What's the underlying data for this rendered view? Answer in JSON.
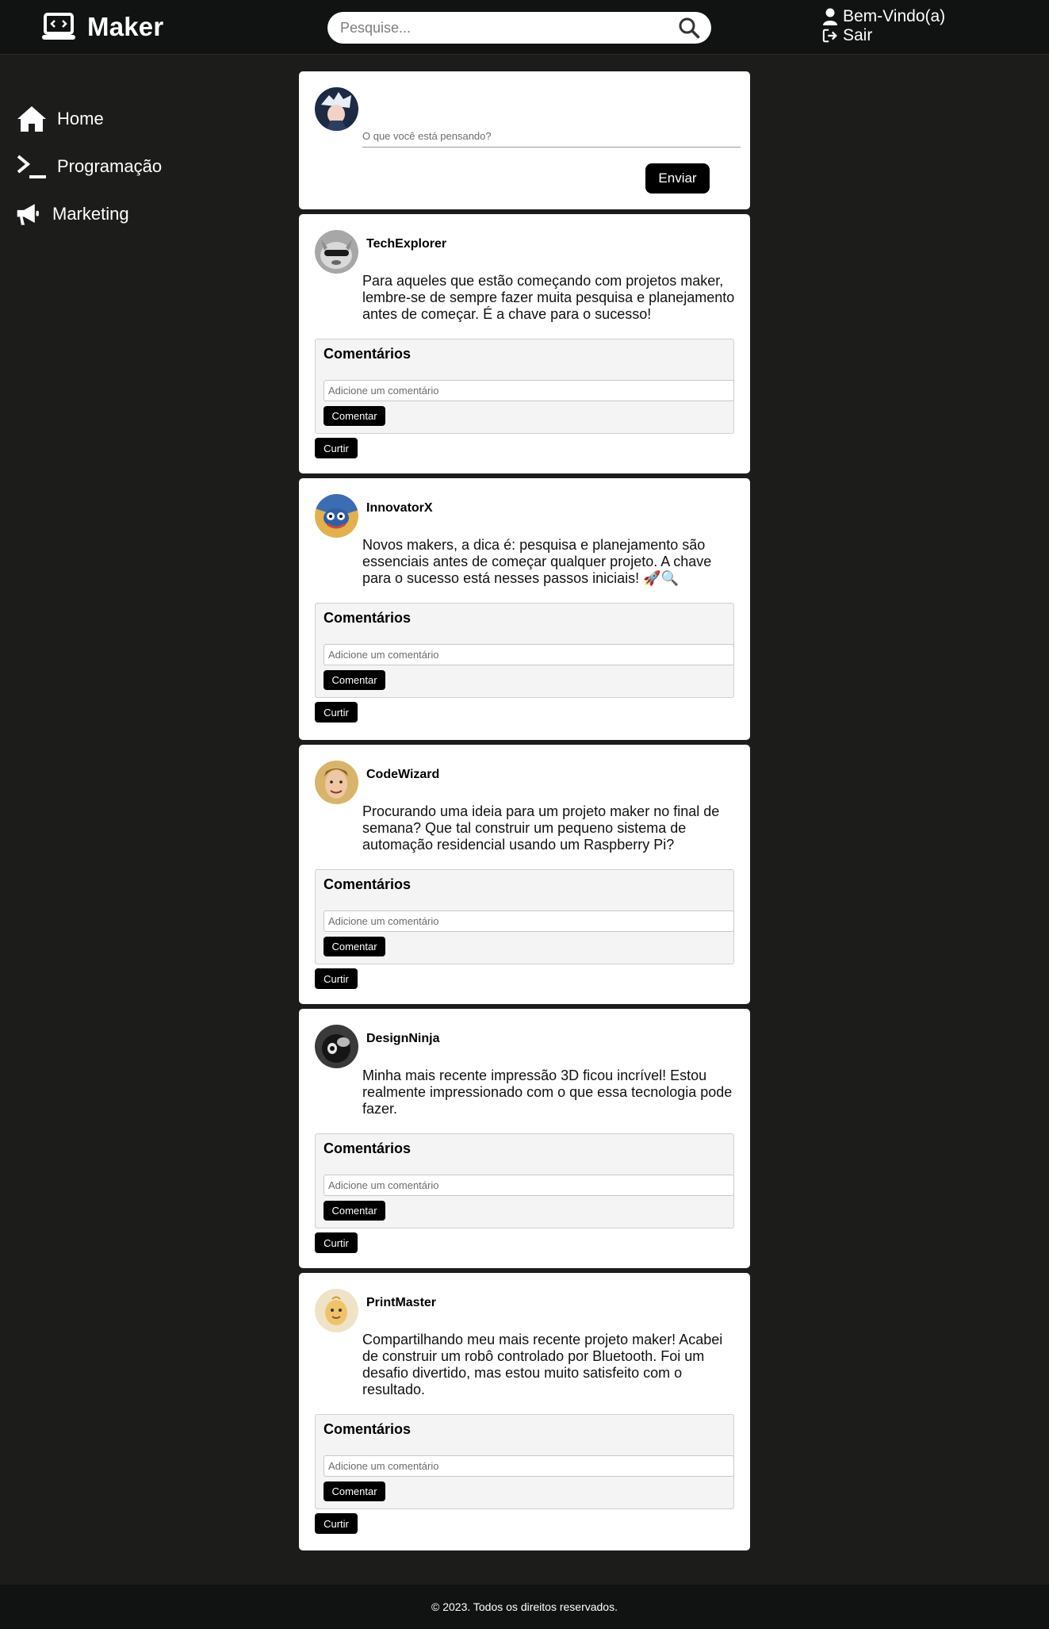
{
  "header": {
    "logo_text": "Maker",
    "search_placeholder": "Pesquise...",
    "welcome": "Bem-Vindo(a)",
    "logout": "Sair"
  },
  "sidebar": {
    "items": [
      {
        "label": "Home",
        "icon": "home-icon"
      },
      {
        "label": "Programação",
        "icon": "terminal-icon"
      },
      {
        "label": "Marketing",
        "icon": "megaphone-icon"
      }
    ]
  },
  "composer": {
    "placeholder": "O que você está pensando?",
    "send_label": "Enviar"
  },
  "labels": {
    "comments_title": "Comentários",
    "comment_placeholder": "Adicione um comentário",
    "comment_button": "Comentar",
    "like_button": "Curtir"
  },
  "posts": [
    {
      "user": "TechExplorer",
      "text": "Para aqueles que estão começando com projetos maker, lembre-se de sempre fazer muita pesquisa e planejamento antes de começar. É a chave para o sucesso!"
    },
    {
      "user": "InnovatorX",
      "text": "Novos makers, a dica é: pesquisa e planejamento são essenciais antes de começar qualquer projeto. A chave para o sucesso está nesses passos iniciais! 🚀🔍"
    },
    {
      "user": "CodeWizard",
      "text": "Procurando uma ideia para um projeto maker no final de semana? Que tal construir um pequeno sistema de automação residencial usando um Raspberry Pi?"
    },
    {
      "user": "DesignNinja",
      "text": "Minha mais recente impressão 3D ficou incrível! Estou realmente impressionado com o que essa tecnologia pode fazer."
    },
    {
      "user": "PrintMaster",
      "text": "Compartilhando meu mais recente projeto maker! Acabei de construir um robô controlado por Bluetooth. Foi um desafio divertido, mas estou muito satisfeito com o resultado."
    }
  ],
  "footer": {
    "text": "© 2023. Todos os direitos reservados."
  }
}
